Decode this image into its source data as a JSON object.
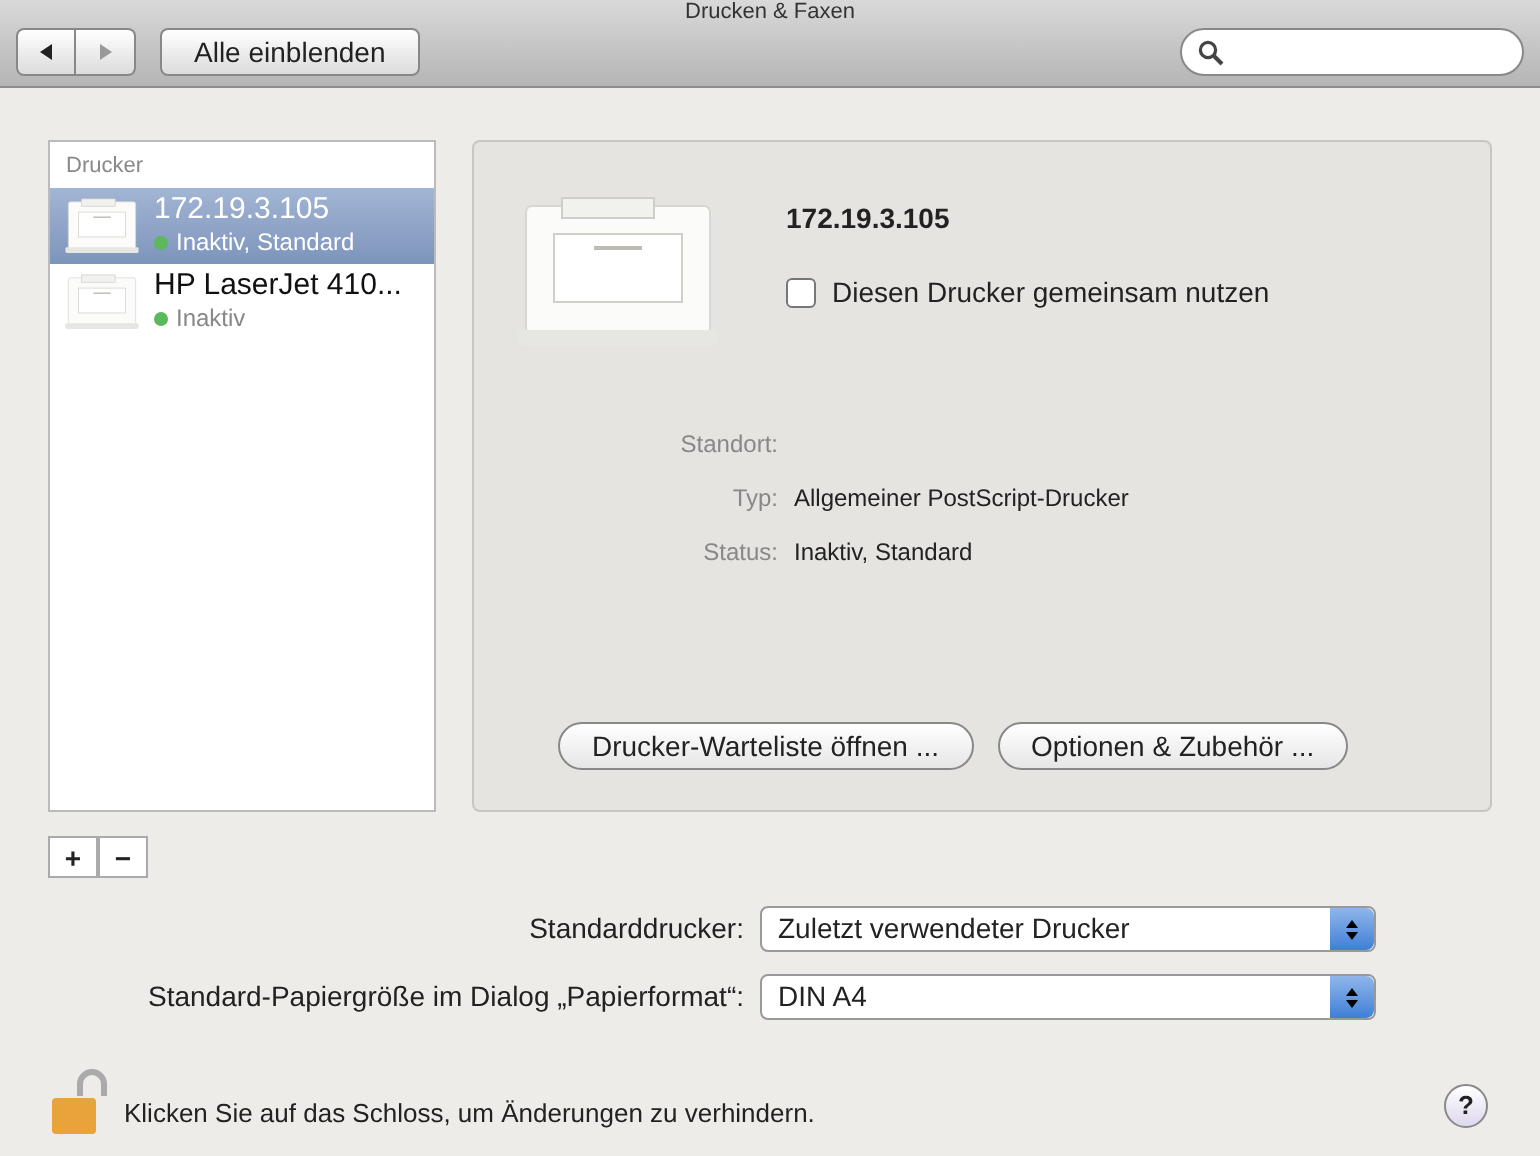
{
  "window": {
    "title": "Drucken & Faxen"
  },
  "toolbar": {
    "back": {
      "disabled": false
    },
    "forward": {
      "disabled": true
    },
    "show_all": "Alle einblenden"
  },
  "sidebar": {
    "heading": "Drucker",
    "items": [
      {
        "name": "172.19.3.105",
        "status": "Inaktiv, Standard",
        "color": "#5cb85c",
        "selected": true
      },
      {
        "name": "HP LaserJet 410...",
        "status": "Inaktiv",
        "color": "#5cb85c",
        "selected": false
      }
    ]
  },
  "detail": {
    "name": "172.19.3.105",
    "share": {
      "label": "Diesen Drucker gemeinsam nutzen",
      "checked": false
    },
    "fields": [
      {
        "label": "Standort:"
      },
      {
        "label": "Typ:",
        "value": "Allgemeiner PostScript-Drucker"
      },
      {
        "label": "Status:",
        "value": "Inaktiv, Standard"
      }
    ],
    "buttons": [
      "Drucker-Warteliste öffnen ...",
      "Optionen & Zubehör ..."
    ]
  },
  "list_buttons": [
    "+",
    "−"
  ],
  "defaults": [
    {
      "label": "Standarddrucker:",
      "value": "Zuletzt verwendeter Drucker"
    },
    {
      "label": "Standard-Papiergröße im Dialog „Papierformat“:",
      "value": "DIN A4"
    }
  ],
  "lock": {
    "text": "Klicken Sie auf das Schloss, um Änderungen zu verhindern.",
    "locked": false
  },
  "help": "?"
}
